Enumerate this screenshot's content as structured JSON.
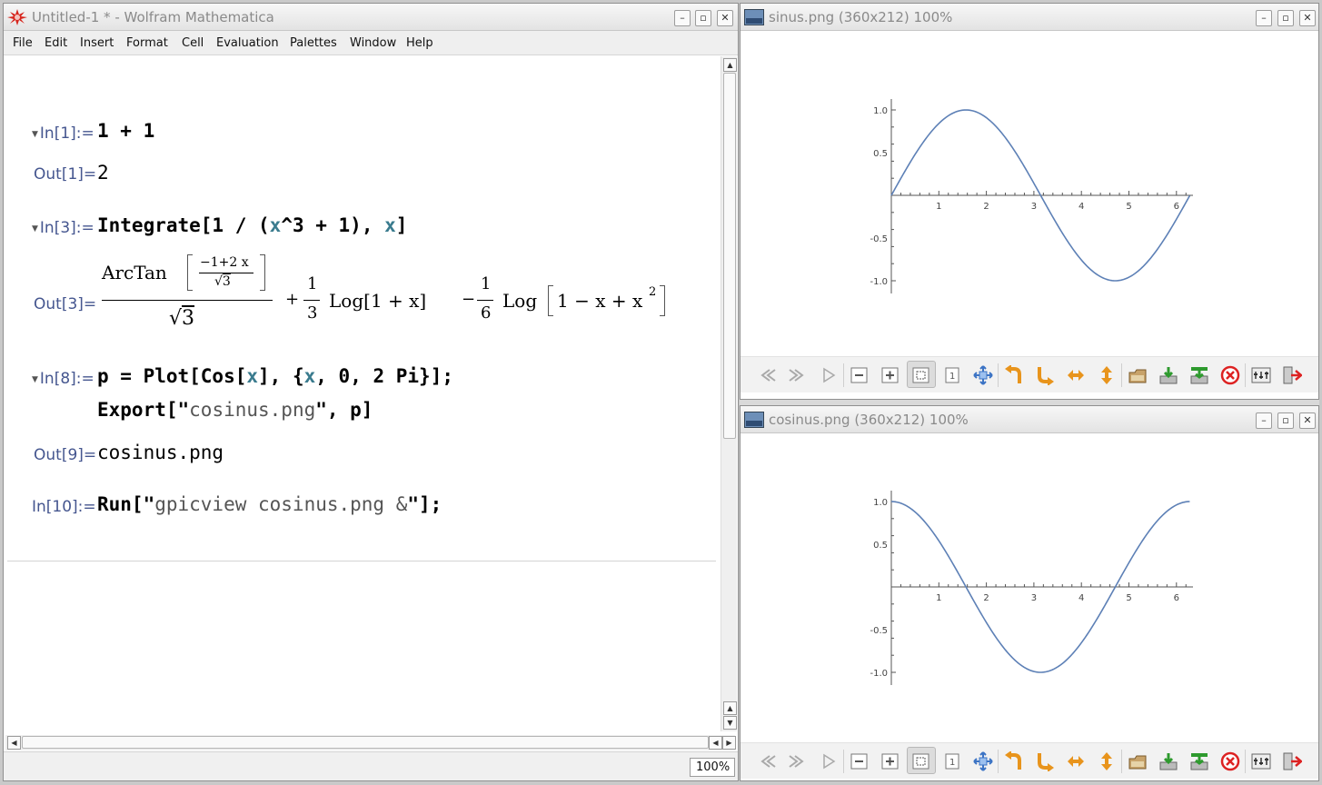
{
  "mathematica": {
    "title": "Untitled-1 * - Wolfram Mathematica",
    "window_buttons": {
      "minimize": "–",
      "maximize": "▫",
      "close": "✕"
    },
    "menu": [
      "File",
      "Edit",
      "Insert",
      "Format",
      "Cell",
      "Evaluation",
      "Palettes",
      "Window",
      "Help"
    ],
    "cells": {
      "in1_label": "In[1]:=",
      "in1_code": "1 + 1",
      "out1_label": "Out[1]=",
      "out1_value": "2",
      "in3_label": "In[3]:=",
      "in3_head": "Integrate[1 / (",
      "in3_x1": "x",
      "in3_mid": "^3 + 1), ",
      "in3_x2": "x",
      "in3_end": "]",
      "out3_label": "Out[3]=",
      "out3": {
        "arctan": "ArcTan",
        "inner_num": "−1+2 x",
        "inner_den": "3",
        "den": "3",
        "plus": "+",
        "one_a": "1",
        "three": "3",
        "log1": "Log",
        "log1_arg": "1 + x",
        "minus": "−",
        "one_b": "1",
        "six": "6",
        "log2": "Log",
        "log2_arg": "1 − x + x",
        "exp": "2"
      },
      "in8_label": "In[8]:=",
      "in8_line1_a": "p = Plot[Cos[",
      "in8_x1": "x",
      "in8_line1_b": "], {",
      "in8_x2": "x",
      "in8_line1_c": ", 0, 2 Pi}];",
      "in8_line2_a": "Export[\"",
      "in8_line2_str": "cosinus.png",
      "in8_line2_b": "\", p]",
      "out9_label": "Out[9]=",
      "out9_value": "cosinus.png",
      "in10_label": "In[10]:=",
      "in10_a": "Run[\"",
      "in10_str": "gpicview cosinus.png &",
      "in10_b": "\"];"
    },
    "zoom": "100%"
  },
  "viewer_sin": {
    "title": "sinus.png (360x212) 100%"
  },
  "viewer_cos": {
    "title": "cosinus.png (360x212) 100%"
  },
  "chart_data": [
    {
      "type": "line",
      "function": "sin(x)",
      "x": [
        0,
        0.5,
        1,
        1.5,
        2,
        2.5,
        3,
        3.5,
        4,
        4.5,
        5,
        5.5,
        6,
        6.28
      ],
      "y": [
        0,
        0.48,
        0.84,
        1.0,
        0.91,
        0.6,
        0.14,
        -0.35,
        -0.76,
        -0.98,
        -0.96,
        -0.71,
        -0.28,
        0
      ],
      "xlim": [
        0,
        6.28
      ],
      "ylim": [
        -1.0,
        1.0
      ],
      "x_ticks": [
        "1",
        "2",
        "3",
        "4",
        "5",
        "6"
      ],
      "y_ticks": [
        "1.0",
        "0.5",
        "-0.5",
        "-1.0"
      ],
      "color": "#5d80b6"
    },
    {
      "type": "line",
      "function": "cos(x)",
      "x": [
        0,
        0.5,
        1,
        1.5,
        2,
        2.5,
        3,
        3.5,
        4,
        4.5,
        5,
        5.5,
        6,
        6.28
      ],
      "y": [
        1.0,
        0.88,
        0.54,
        0.07,
        -0.42,
        -0.8,
        -0.99,
        -0.94,
        -0.65,
        -0.21,
        0.28,
        0.71,
        0.96,
        1.0
      ],
      "xlim": [
        0,
        6.28
      ],
      "ylim": [
        -1.0,
        1.0
      ],
      "x_ticks": [
        "1",
        "2",
        "3",
        "4",
        "5",
        "6"
      ],
      "y_ticks": [
        "1.0",
        "0.5",
        "-0.5",
        "-1.0"
      ],
      "color": "#5d80b6"
    }
  ]
}
